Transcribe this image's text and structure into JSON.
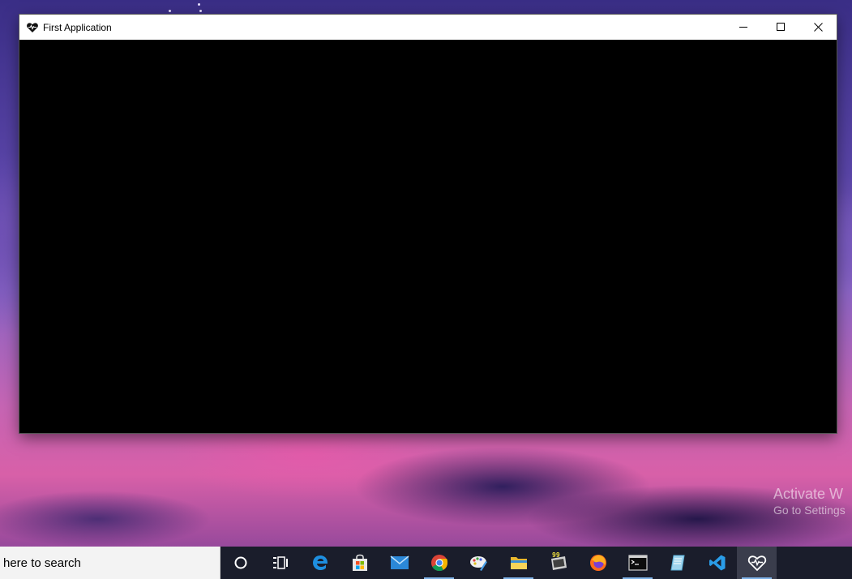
{
  "window": {
    "title": "First Application",
    "controls": {
      "minimize": "minimize",
      "maximize": "maximize",
      "close": "close"
    }
  },
  "desktop": {
    "watermark_line1": "Activate W",
    "watermark_line2": "Go to Settings"
  },
  "taskbar": {
    "search_text": "here to search",
    "items": [
      {
        "name": "cortana-icon"
      },
      {
        "name": "task-view-icon"
      },
      {
        "name": "edge-icon"
      },
      {
        "name": "store-icon"
      },
      {
        "name": "mail-icon"
      },
      {
        "name": "chrome-icon"
      },
      {
        "name": "paint-icon"
      },
      {
        "name": "file-explorer-icon"
      },
      {
        "name": "app-99-icon",
        "badge": "99"
      },
      {
        "name": "firefox-icon"
      },
      {
        "name": "terminal-icon"
      },
      {
        "name": "notes-icon"
      },
      {
        "name": "vscode-icon"
      },
      {
        "name": "first-application-icon"
      }
    ]
  },
  "colors": {
    "titlebar": "#ffffff",
    "client": "#000000",
    "taskbar": "#1a1d2b",
    "accent": "#7fb2e8"
  }
}
